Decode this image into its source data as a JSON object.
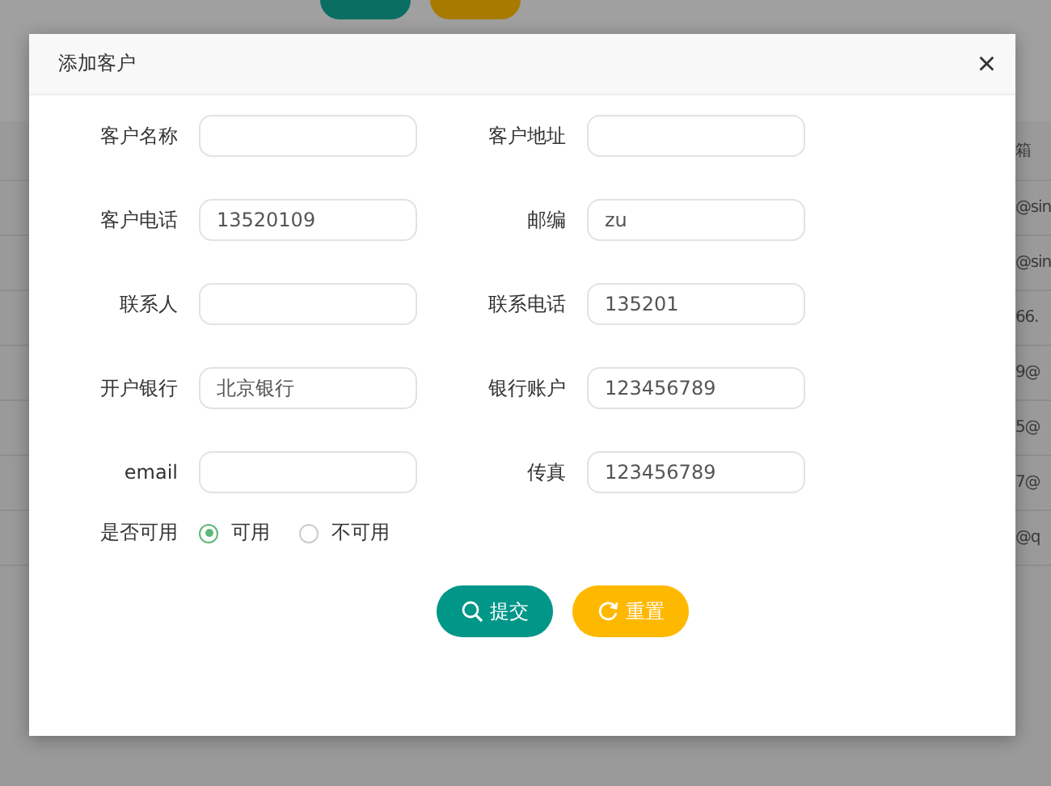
{
  "background_table": {
    "header": "箱",
    "cells": [
      "@sin",
      "@sin",
      "66.",
      "9@",
      "5@",
      "7@",
      "@q"
    ]
  },
  "dialog": {
    "title": "添加客户",
    "close": "×"
  },
  "fields": [
    {
      "kind": "input",
      "label": "客户名称"
    },
    {
      "kind": "input",
      "label": "客户地址"
    },
    {
      "kind": "input",
      "label": "客户电话",
      "value": "13520109"
    },
    {
      "kind": "input",
      "label": "邮编",
      "value": "zu"
    },
    {
      "kind": "input",
      "label": "联系人"
    },
    {
      "kind": "input",
      "label": "联系电话",
      "value": "135201"
    },
    {
      "kind": "input",
      "label": "开户银行",
      "value": "北京银行"
    },
    {
      "kind": "input",
      "label": "银行账户",
      "value": "123456789"
    },
    {
      "kind": "input",
      "label": "email"
    },
    {
      "kind": "input",
      "label": "传真",
      "value": "123456789"
    }
  ],
  "available": {
    "label": "是否可用",
    "options": [
      {
        "label": "可用",
        "selected": true
      },
      {
        "label": "不可用",
        "selected": false
      }
    ]
  },
  "buttons": [
    {
      "kind": "submit",
      "label": "提交"
    },
    {
      "kind": "reset",
      "label": "重置"
    }
  ]
}
